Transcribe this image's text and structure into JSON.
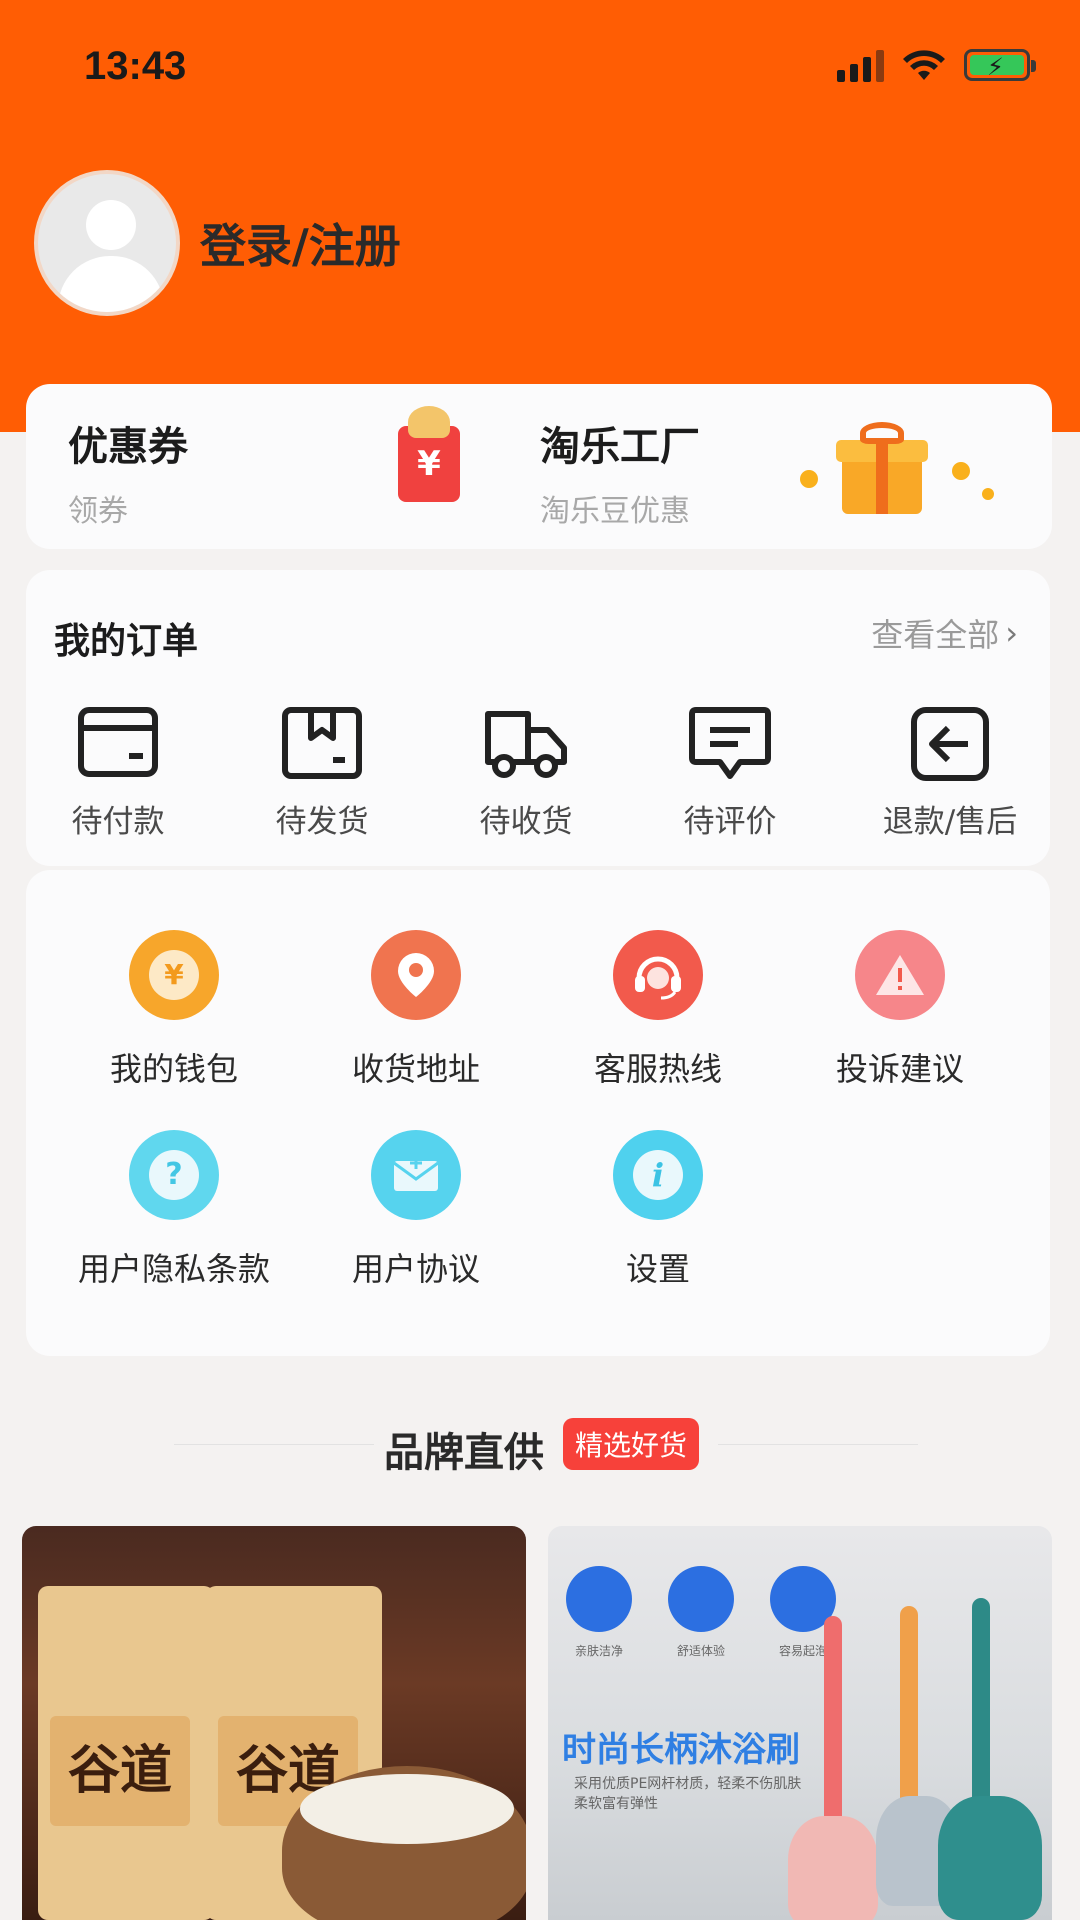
{
  "status_bar": {
    "time": "13:43"
  },
  "profile": {
    "login_label": "登录/注册"
  },
  "promos": [
    {
      "title": "优惠券",
      "subtitle": "领券",
      "icon": "red-packet-icon"
    },
    {
      "title": "淘乐工厂",
      "subtitle": "淘乐豆优惠",
      "icon": "gift-box-icon"
    }
  ],
  "orders": {
    "title": "我的订单",
    "view_all": "查看全部",
    "items": [
      {
        "label": "待付款",
        "icon": "wallet-icon"
      },
      {
        "label": "待发货",
        "icon": "package-icon"
      },
      {
        "label": "待收货",
        "icon": "truck-icon"
      },
      {
        "label": "待评价",
        "icon": "comment-icon"
      },
      {
        "label": "退款/售后",
        "icon": "return-icon"
      }
    ]
  },
  "services": [
    {
      "label": "我的钱包",
      "icon": "yen-coin-icon",
      "color": "#f7a62b"
    },
    {
      "label": "收货地址",
      "icon": "location-pin-icon",
      "color": "#f0744f"
    },
    {
      "label": "客服热线",
      "icon": "headset-icon",
      "color": "#f25a4c"
    },
    {
      "label": "投诉建议",
      "icon": "warning-icon",
      "color": "#f6868a"
    },
    {
      "label": "用户隐私条款",
      "icon": "question-icon",
      "color": "#60d7ee"
    },
    {
      "label": "用户协议",
      "icon": "envelope-icon",
      "color": "#56d3ee"
    },
    {
      "label": "设置",
      "icon": "info-icon",
      "color": "#4fd1ee"
    }
  ],
  "brand": {
    "title": "品牌直供",
    "badge": "精选好货"
  },
  "products": [
    {
      "name": "谷道",
      "pack_label": "谷道"
    },
    {
      "title": "时尚长柄沐浴刷",
      "desc": "采用优质PE网杆材质，轻柔不伤肌肤 柔软富有弹性",
      "features": [
        "亲肤洁净",
        "舒适体验",
        "容易起泡"
      ]
    }
  ],
  "colors": {
    "brand_orange": "#ff5d04",
    "badge_red": "#f7413a"
  }
}
